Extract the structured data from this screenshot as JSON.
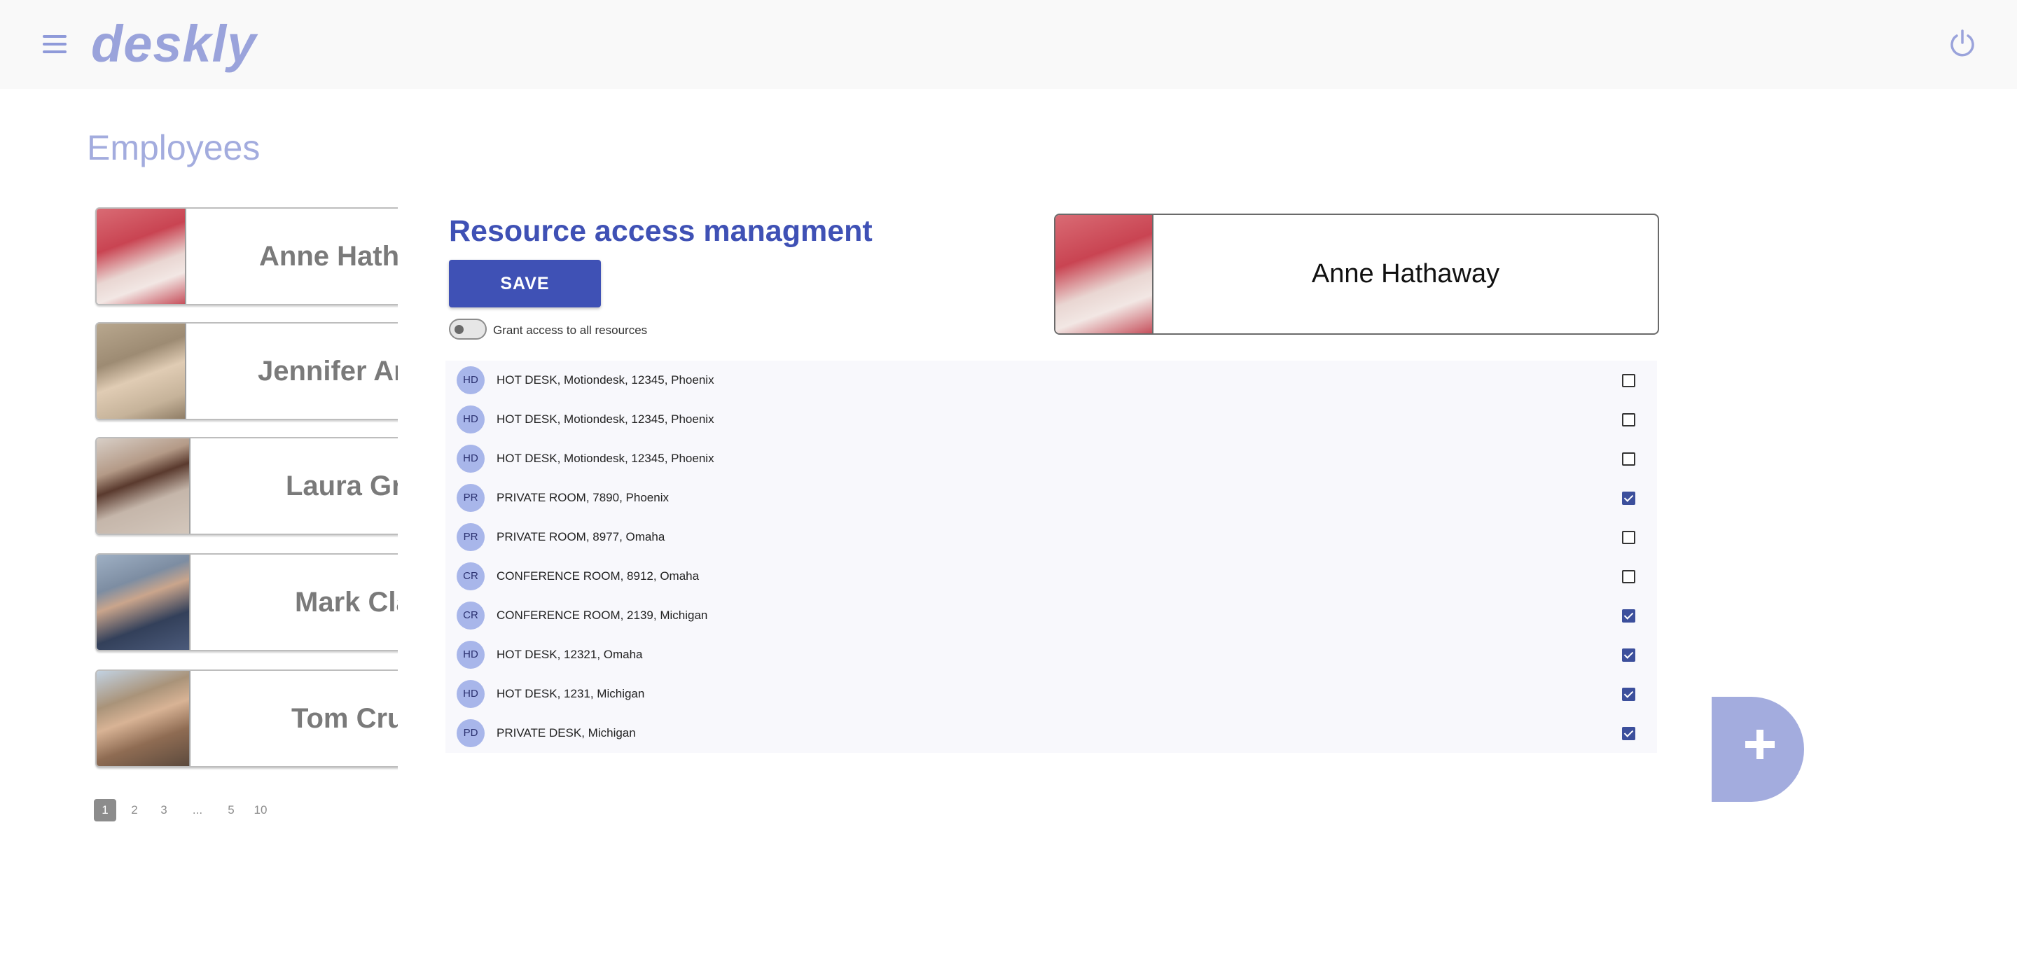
{
  "header": {
    "app_name": "deskly"
  },
  "page": {
    "title": "Employees"
  },
  "employees": [
    {
      "name": "Anne Hathaway"
    },
    {
      "name": "Jennifer Aniston"
    },
    {
      "name": "Laura Green"
    },
    {
      "name": "Mark Clark"
    },
    {
      "name": "Tom Cruise"
    }
  ],
  "pagination": [
    "1",
    "2",
    "3",
    "...",
    "5",
    "10"
  ],
  "resource_panel": {
    "title": "Resource access managment",
    "save_label": "SAVE",
    "toggle_label": "Grant access to all resources",
    "selected_employee": "Anne Hathaway"
  },
  "resources": [
    {
      "badge": "HD",
      "label": "HOT DESK, Motiondesk, 12345, Phoenix",
      "checked": false
    },
    {
      "badge": "HD",
      "label": "HOT DESK, Motiondesk, 12345, Phoenix",
      "checked": false
    },
    {
      "badge": "HD",
      "label": "HOT DESK, Motiondesk, 12345, Phoenix",
      "checked": false
    },
    {
      "badge": "PR",
      "label": "PRIVATE ROOM, 7890, Phoenix",
      "checked": true
    },
    {
      "badge": "PR",
      "label": "PRIVATE ROOM, 8977, Omaha",
      "checked": false
    },
    {
      "badge": "CR",
      "label": "CONFERENCE ROOM, 8912, Omaha",
      "checked": false
    },
    {
      "badge": "CR",
      "label": "CONFERENCE ROOM, 2139, Michigan",
      "checked": true
    },
    {
      "badge": "HD",
      "label": "HOT DESK, 12321, Omaha",
      "checked": true
    },
    {
      "badge": "HD",
      "label": "HOT DESK, 1231, Michigan",
      "checked": true
    },
    {
      "badge": "PD",
      "label": "PRIVATE DESK, Michigan",
      "checked": true
    }
  ],
  "colors": {
    "accent": "#3f51b5",
    "logo": "#9aa3db",
    "badge": "#a8b6ea",
    "fab": "#a3acde"
  }
}
